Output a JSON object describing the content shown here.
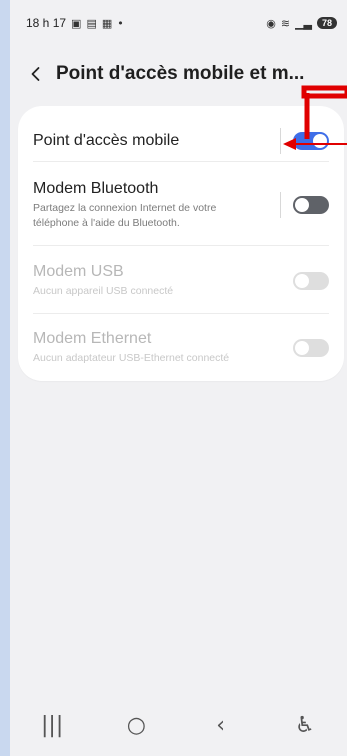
{
  "status_bar": {
    "time": "18 h 17",
    "left_icons": [
      "gallery-icon",
      "signal-grid-icon",
      "grid-icon"
    ],
    "dot": "•",
    "right_icons": [
      "hotspot-icon",
      "wifi-icon",
      "signal-icon"
    ],
    "battery": "78"
  },
  "header": {
    "title": "Point d'accès mobile et m..."
  },
  "settings": [
    {
      "label": "Point d'accès mobile",
      "subtitle": "",
      "enabled": true,
      "toggle_state": "on"
    },
    {
      "label": "Modem Bluetooth",
      "subtitle": "Partagez la connexion Internet de votre téléphone à l'aide du Bluetooth.",
      "enabled": true,
      "toggle_state": "off"
    },
    {
      "label": "Modem USB",
      "subtitle": "Aucun appareil USB connecté",
      "enabled": false,
      "toggle_state": "off"
    },
    {
      "label": "Modem Ethernet",
      "subtitle": "Aucun adaptateur USB-Ethernet connecté",
      "enabled": false,
      "toggle_state": "off"
    }
  ],
  "navigation": {
    "items": [
      "recent-apps-icon",
      "home-icon",
      "back-icon",
      "accessibility-icon"
    ]
  },
  "colors": {
    "page_background": "#f1f1f3",
    "card_background": "#ffffff",
    "toggle_on": "#3f6ee8",
    "toggle_off": "#5f6268",
    "annotation": "#e00000"
  }
}
